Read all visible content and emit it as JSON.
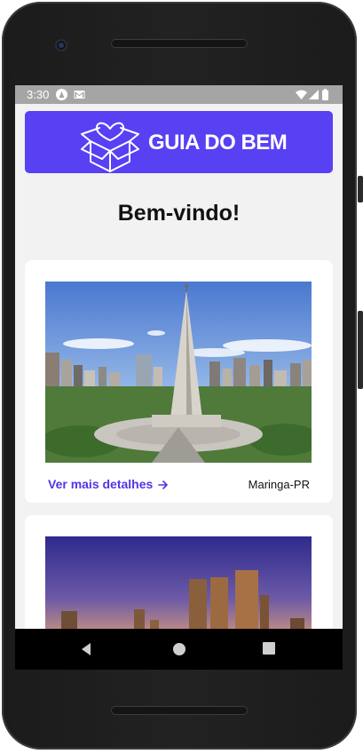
{
  "status_bar": {
    "time": "3:30",
    "left_icons": [
      "android-auto-icon",
      "gmail-icon"
    ],
    "right_icons": [
      "wifi-icon",
      "signal-icon",
      "battery-icon"
    ]
  },
  "header": {
    "logo_icon": "heart-box-icon",
    "brand": "GUIA DO BEM",
    "color": "#5840f3"
  },
  "welcome": "Bem-vindo!",
  "cards": [
    {
      "image": "cathedral-photo",
      "link_label": "Ver mais detalhes",
      "link_icon": "arrow-right-icon",
      "location": "Maringa-PR"
    },
    {
      "image": "city-sunset-photo"
    }
  ],
  "nav": [
    "back-icon",
    "home-icon",
    "recents-icon"
  ]
}
